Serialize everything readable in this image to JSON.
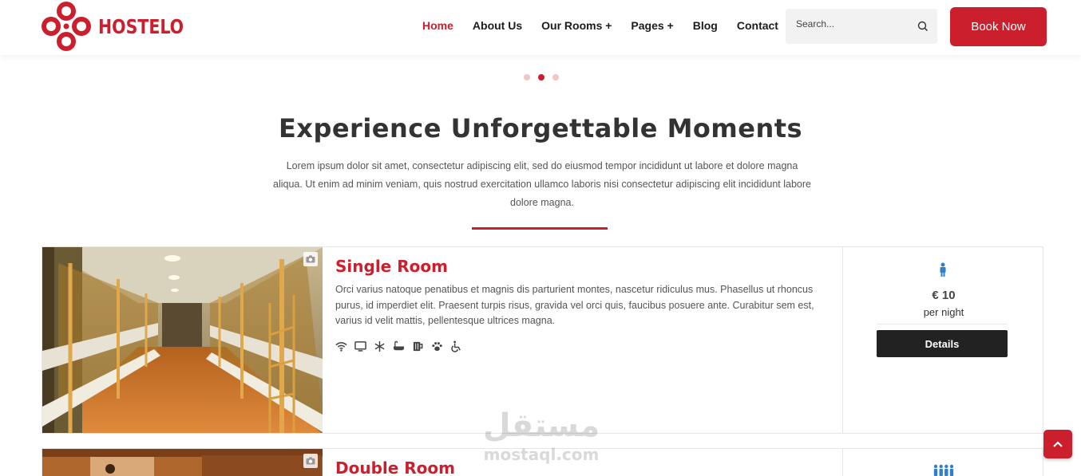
{
  "brand": {
    "name": "HOSTELO",
    "accent": "#cc1f2d"
  },
  "nav": {
    "items": [
      {
        "label": "Home"
      },
      {
        "label": "About Us"
      },
      {
        "label": "Our Rooms +"
      },
      {
        "label": "Pages +"
      },
      {
        "label": "Blog"
      },
      {
        "label": "Contact"
      }
    ]
  },
  "search": {
    "placeholder": "Search...",
    "icon": "search-icon"
  },
  "book_button": {
    "label": "Book Now"
  },
  "slider": {
    "dots": 3,
    "active": 2
  },
  "section": {
    "title": "Experience Unforgettable Moments",
    "intro": "Lorem ipsum dolor sit amet, consectetur adipiscing elit, sed do eiusmod tempor incididunt ut labore et dolore magna aliqua. Ut enim ad minim veniam, quis nostrud exercitation ullamco laboris nisi consectetur adipiscing elit incididunt labore dolore magna."
  },
  "rooms": [
    {
      "title": "Single Room",
      "description": "Orci varius natoque penatibus et magnis dis parturient montes, nascetur ridiculus mus. Phasellus ut rhoncus purus, id imperdiet elit. Praesent turpis risus, gravida vel orci quis, faucibus posuere ante. Curabitur sem est, varius id velit mattis, pellentesque ultrices magna.",
      "amenities": [
        "wifi-icon",
        "tv-icon",
        "snowflake-icon",
        "bath-icon",
        "mug-icon",
        "paw-icon",
        "wheelchair-icon"
      ],
      "price": "€ 10",
      "per": "per night",
      "details_label": "Details",
      "occupancy_icon": "person-icon"
    },
    {
      "title": "Double Room",
      "occupancy_icon": "group-icon"
    }
  ],
  "watermark": {
    "arabic": "مستقل",
    "latin": "mostaql.com"
  },
  "back_to_top": {
    "icon": "chevron-up-icon"
  }
}
